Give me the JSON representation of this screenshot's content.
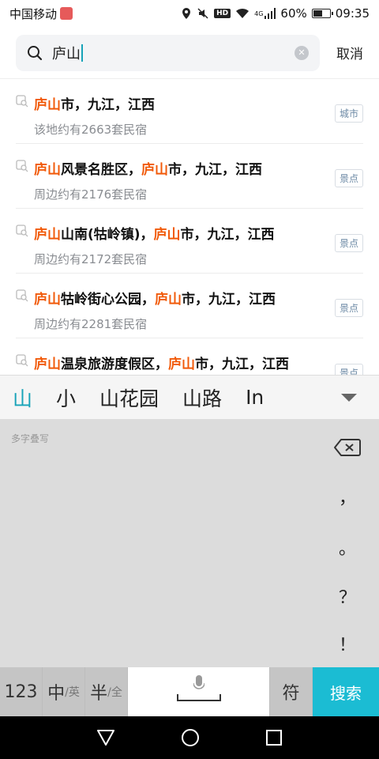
{
  "status": {
    "carrier": "中国移动",
    "network": "4G",
    "battery": "60%",
    "battery_level": 0.6,
    "time": "09:35"
  },
  "search": {
    "query": "庐山",
    "cancel_label": "取消"
  },
  "results": [
    {
      "hl": "庐山",
      "rest": "市，九江，江西",
      "hl2": "",
      "rest2": "",
      "sub": "该地约有2663套民宿",
      "tag": "城市"
    },
    {
      "hl": "庐山",
      "rest": "风景名胜区，",
      "hl2": "庐山",
      "rest2": "市，九江，江西",
      "sub": "周边约有2176套民宿",
      "tag": "景点"
    },
    {
      "hl": "庐山",
      "rest": "山南(牯岭镇)，",
      "hl2": "庐山",
      "rest2": "市，九江，江西",
      "sub": "周边约有2172套民宿",
      "tag": "景点"
    },
    {
      "hl": "庐山",
      "rest": "牯岭街心公园，",
      "hl2": "庐山",
      "rest2": "市，九江，江西",
      "sub": "周边约有2281套民宿",
      "tag": "景点"
    },
    {
      "hl": "庐山",
      "rest": "温泉旅游度假区，",
      "hl2": "庐山",
      "rest2": "市，九江，江西",
      "sub": "",
      "tag": "景点"
    }
  ],
  "keyboard": {
    "candidates": [
      "山",
      "小",
      "山花园",
      "山路",
      "In"
    ],
    "hw_label": "多字叠写",
    "punctuation": [
      "，",
      "。",
      "？",
      "！"
    ],
    "keys": {
      "num": "123",
      "zh_main": "中",
      "zh_sub": "/英",
      "half_main": "半",
      "half_sub": "/全",
      "symbol": "符",
      "search": "搜索"
    }
  },
  "colors": {
    "accent": "#17a3b8",
    "highlight": "#f15a0a",
    "search_key": "#1bbcd3"
  }
}
